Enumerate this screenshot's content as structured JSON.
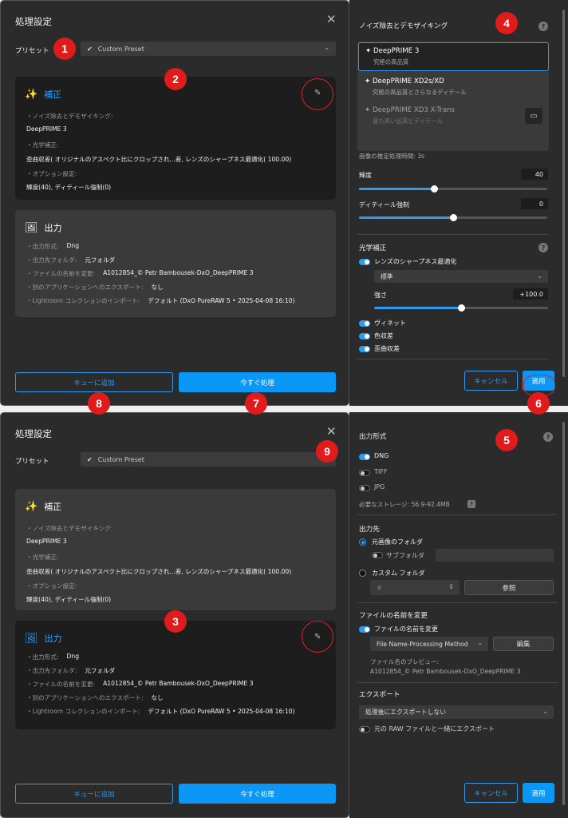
{
  "top": {
    "dialog": {
      "title": "処理設定",
      "preset_label": "プリセット",
      "preset_value": "Custom Preset",
      "correction": {
        "title": "補正",
        "rows": [
          {
            "key": "・ノイズ除去とデモザイキング:",
            "value": "DeepPRIME 3"
          },
          {
            "key": "・光学補正:",
            "value": "歪曲収差( オリジナルのアスペクト比にクロップされ...差, レンズのシャープネス最適化( 100.00)"
          },
          {
            "key": "・オプション設定:",
            "value": "輝度(40), ディティール強制(0)"
          }
        ]
      },
      "output": {
        "title": "出力",
        "rows": [
          {
            "key": "・出力形式:",
            "value": "Dng"
          },
          {
            "key": "・出力先フォルダ:",
            "value": "元フォルダ"
          },
          {
            "key": "・ファイルの名前を変更:",
            "value": "A1012854_© Petr Bambousek-DxO_DeepPRIME 3"
          },
          {
            "key": "・別のアプリケーションへのエクスポート:",
            "value": "なし"
          },
          {
            "key": "・Lightroom コレクションのインポート:",
            "value": "デフォルト (DxO PureRAW 5 • 2025-04-08 16:10)"
          }
        ]
      },
      "queue_button": "キューに追加",
      "process_button": "今すぐ処理"
    },
    "panel": {
      "title": "ノイズ除去とデモザイキング",
      "options": [
        {
          "name": "DeepPRIME 3",
          "desc": "究極の高品質",
          "state": "selected"
        },
        {
          "name": "DeepPRIME XD2s/XD",
          "desc": "究極の高品質とさらなるディテール",
          "state": "normal"
        },
        {
          "name": "DeepPRIME XD3 X-Trans",
          "desc": "最も高い品質とディテール",
          "state": "disabled"
        }
      ],
      "estimate": "画像の推定処理時間: 3s",
      "luminance_label": "輝度",
      "luminance_value": "40",
      "luminance_level": 0.4,
      "detail_label": "ディティール強制",
      "detail_value": "0",
      "detail_level": 0.5,
      "optical_title": "光学補正",
      "sharpness_label": "レンズのシャープネス最適化",
      "sharpness_mode": "標準",
      "strength_label": "強さ",
      "strength_value": "+100.0",
      "strength_level": 0.5,
      "vignette_label": "ヴィネット",
      "chromatic_label": "色収差",
      "distortion_label": "歪曲収差",
      "cancel_button": "キャンセル",
      "apply_button": "適用"
    }
  },
  "bottom": {
    "dialog": {
      "title": "処理設定",
      "preset_label": "プリセット",
      "preset_value": "Custom Preset",
      "correction": {
        "title": "補正",
        "rows": [
          {
            "key": "・ノイズ除去とデモザイキング:",
            "value": "DeepPRIME 3"
          },
          {
            "key": "・光学補正:",
            "value": "歪曲収差( オリジナルのアスペクト比にクロップされ...差, レンズのシャープネス最適化( 100.00)"
          },
          {
            "key": "・オプション設定:",
            "value": "輝度(40), ディティール強制(0)"
          }
        ]
      },
      "output": {
        "title": "出力",
        "rows": [
          {
            "key": "・出力形式:",
            "value": "Dng"
          },
          {
            "key": "・出力先フォルダ:",
            "value": "元フォルダ"
          },
          {
            "key": "・ファイルの名前を変更:",
            "value": "A1012854_© Petr Bambousek-DxO_DeepPRIME 3"
          },
          {
            "key": "・別のアプリケーションへのエクスポート:",
            "value": "なし"
          },
          {
            "key": "・Lightroom コレクションのインポート:",
            "value": "デフォルト (DxO PureRAW 5 • 2025-04-08 16:10)"
          }
        ]
      },
      "queue_button": "キューに追加",
      "process_button": "今すぐ処理"
    },
    "panel": {
      "output_format_title": "出力形式",
      "formats": [
        "DNG",
        "TIFF",
        "JPG"
      ],
      "storage": "必要なストレージ: 56.9-92.4MB",
      "destination_title": "出力先",
      "source_folder": "元画像のフォルダ",
      "subfolder": "サブフォルダ",
      "custom_folder": "カスタム フォルダ",
      "custom_folder_value": "☆",
      "browse_button": "参照",
      "rename_title": "ファイルの名前を変更",
      "rename_toggle": "ファイルの名前を変更",
      "rename_method": "File Name-Processing Method",
      "edit_button": "編集",
      "preview_label": "ファイル名のプレビュー:",
      "preview_value": "A1012854_© Petr Bambousek-DxO_DeepPRIME 3",
      "export_title": "エクスポート",
      "export_value": "処理後にエクスポートしない",
      "export_raw": "元の RAW ファイルと一緒にエクスポート",
      "cancel_button": "キャンセル",
      "apply_button": "適用"
    }
  },
  "badges": [
    "1",
    "2",
    "3",
    "4",
    "5",
    "6",
    "7",
    "8",
    "9"
  ],
  "colors": {
    "accent": "#2e9bf0",
    "badge": "#e01b1b",
    "background": "#2b2b2b"
  }
}
